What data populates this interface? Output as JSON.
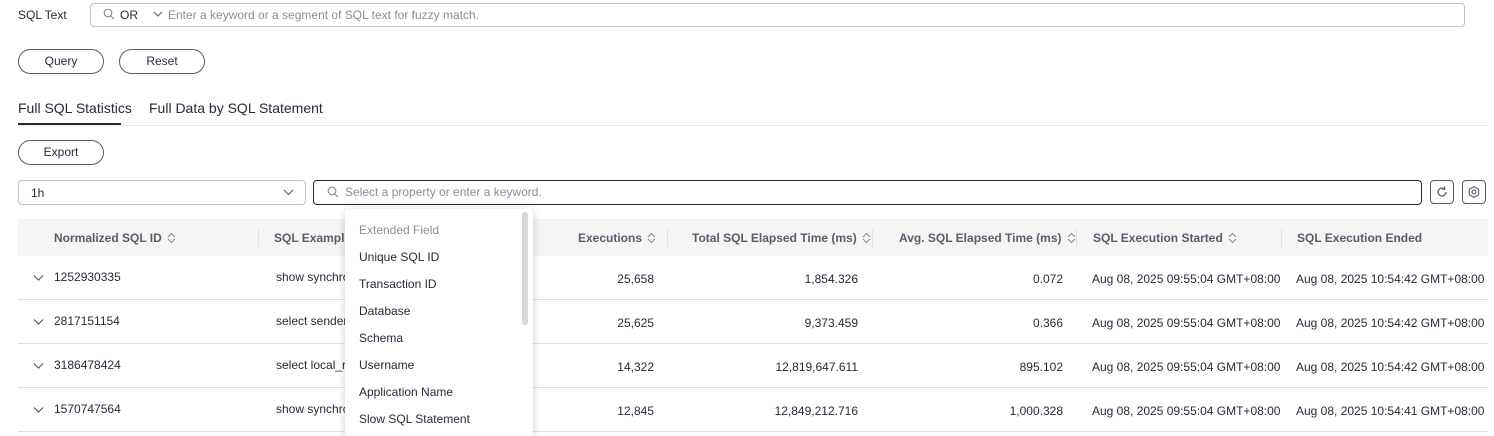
{
  "filter": {
    "sql_text_label": "SQL Text",
    "operator": "OR",
    "sql_placeholder": "Enter a keyword or a segment of SQL text for fuzzy match.",
    "query_label": "Query",
    "reset_label": "Reset"
  },
  "tabs": [
    {
      "label": "Full SQL Statistics",
      "active": true
    },
    {
      "label": "Full Data by SQL Statement",
      "active": false
    }
  ],
  "toolbar": {
    "export_label": "Export",
    "time_range": "1h",
    "property_placeholder": "Select a property or enter a keyword."
  },
  "table": {
    "columns": [
      "Normalized SQL ID",
      "SQL Example",
      "Executions",
      "Total SQL Elapsed Time (ms)",
      "Avg. SQL Elapsed Time (ms)",
      "SQL Execution Started",
      "SQL Execution Ended"
    ],
    "rows": [
      {
        "id": "1252930335",
        "sql": "show synchron",
        "executions": "25,658",
        "total": "1,854.326",
        "avg": "0.072",
        "started": "Aug 08, 2025 09:55:04 GMT+08:00",
        "ended": "Aug 08, 2025 10:54:42 GMT+08:00"
      },
      {
        "id": "2817151154",
        "sql": "select sender_",
        "executions": "25,625",
        "total": "9,373.459",
        "avg": "0.366",
        "started": "Aug 08, 2025 09:55:04 GMT+08:00",
        "ended": "Aug 08, 2025 10:54:42 GMT+08:00"
      },
      {
        "id": "3186478424",
        "sql": "select local_ro",
        "executions": "14,322",
        "total": "12,819,647.611",
        "avg": "895.102",
        "started": "Aug 08, 2025 09:55:04 GMT+08:00",
        "ended": "Aug 08, 2025 10:54:42 GMT+08:00"
      },
      {
        "id": "1570747564",
        "sql": "show synchron",
        "executions": "12,845",
        "total": "12,849,212.716",
        "avg": "1,000.328",
        "started": "Aug 08, 2025 09:55:04 GMT+08:00",
        "ended": "Aug 08, 2025 10:54:41 GMT+08:00"
      }
    ]
  },
  "dropdown": {
    "header": "Extended Field",
    "items": [
      "Unique SQL ID",
      "Transaction ID",
      "Database",
      "Schema",
      "Username",
      "Application Name",
      "Slow SQL Statement"
    ]
  },
  "icons": {
    "search": "search-icon",
    "chevron": "chevron-down-icon",
    "refresh": "refresh-icon",
    "settings": "gear-icon",
    "sort": "sort-icon"
  }
}
